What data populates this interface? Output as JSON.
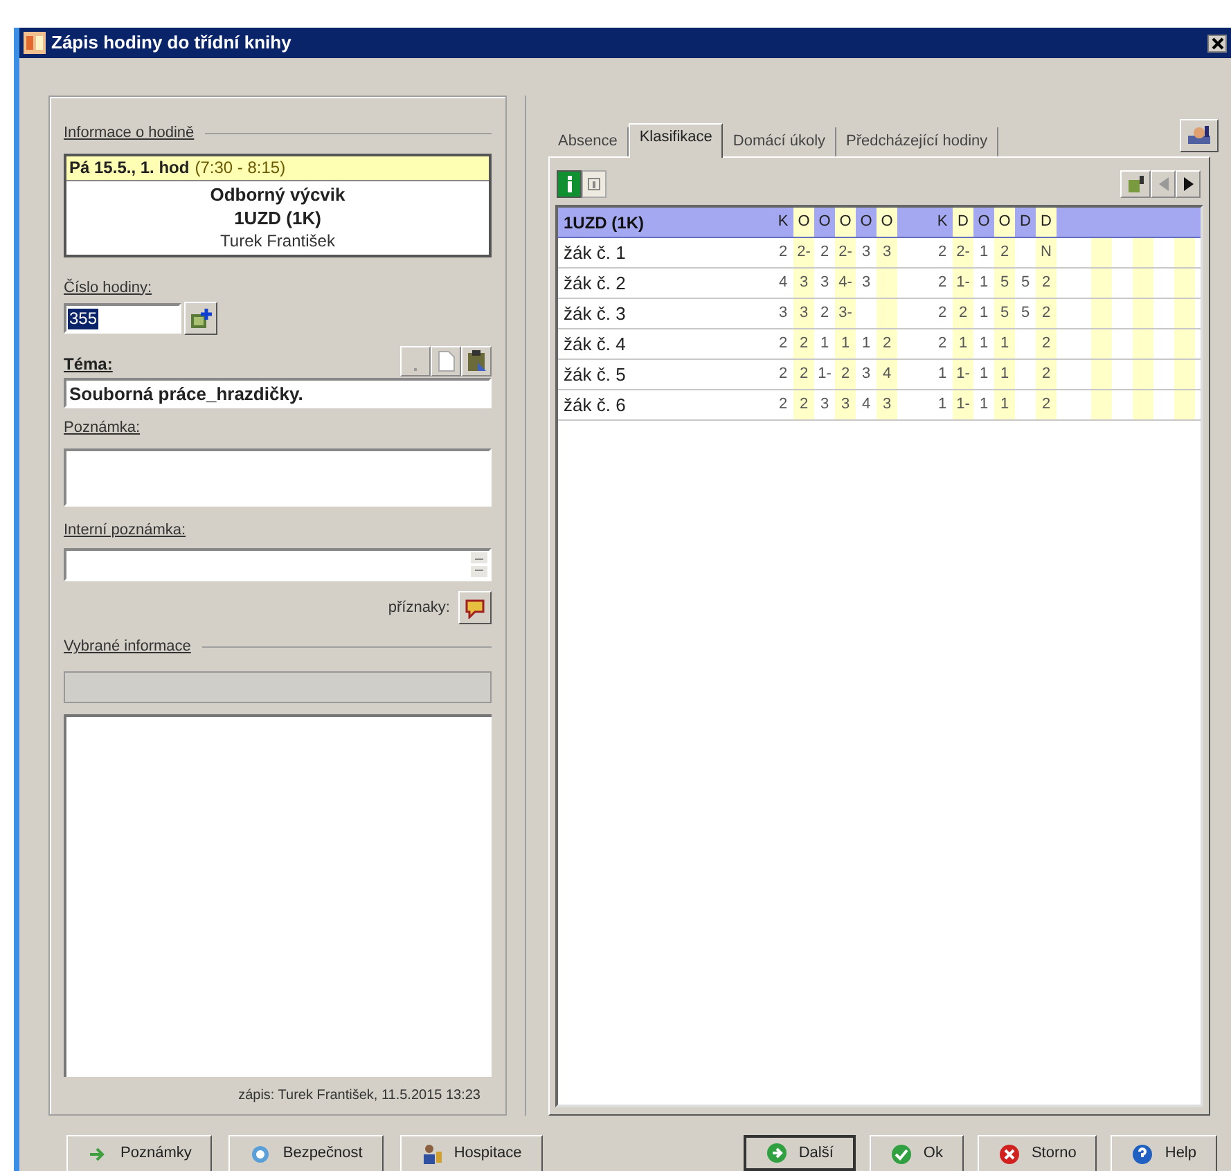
{
  "window": {
    "title": "Zápis hodiny do třídní knihy"
  },
  "lesson_info": {
    "heading": "Informace o hodině",
    "date": "Pá 15.5., 1. hod",
    "time": "(7:30 - 8:15)",
    "subject": "Odborný výcvik",
    "class": "1UZD (1K)",
    "teacher": "Turek František"
  },
  "lesson_number": {
    "label": "Číslo hodiny:",
    "value": "355"
  },
  "topic": {
    "label": "Téma:",
    "value": "Souborná práce_hrazdičky."
  },
  "note": {
    "label": "Poznámka:"
  },
  "internal_note": {
    "label": "Interní poznámka:"
  },
  "flags": {
    "label": "příznaky:"
  },
  "selected_info": {
    "heading": "Vybrané informace"
  },
  "entry_footer": "zápis: Turek František, 11.5.2015 13:23",
  "tabs": [
    {
      "label": "Absence",
      "selected": false
    },
    {
      "label": "Klasifikace",
      "selected": true
    },
    {
      "label": "Domácí úkoly",
      "selected": false
    },
    {
      "label": "Předcházející hodiny",
      "selected": false
    }
  ],
  "grades": {
    "class": "1UZD (1K)",
    "columns_a": [
      "K",
      "O",
      "O",
      "O",
      "O",
      "O"
    ],
    "columns_b": [
      "K",
      "D",
      "O",
      "O",
      "D",
      "D"
    ],
    "rows": [
      {
        "name": "žák č. 1",
        "a": [
          {
            "value": "2"
          },
          {
            "value": "2-"
          },
          {
            "value": "2"
          },
          {
            "value": "2-"
          },
          {
            "value": "3"
          },
          {
            "value": "3"
          }
        ],
        "b": [
          {
            "value": "2"
          },
          {
            "value": "2-"
          },
          {
            "value": "1"
          },
          {
            "value": "2"
          },
          {
            "blank": true
          },
          {
            "value": "N"
          }
        ]
      },
      {
        "name": "žák č. 2",
        "a": [
          {
            "value": "4"
          },
          {
            "value": "3"
          },
          {
            "value": "3"
          },
          {
            "value": "4-"
          },
          {
            "value": "3"
          },
          {
            "blank": true
          }
        ],
        "b": [
          {
            "value": "2"
          },
          {
            "value": "1-"
          },
          {
            "value": "1"
          },
          {
            "value": "5"
          },
          {
            "value": "5"
          },
          {
            "value": "2"
          }
        ]
      },
      {
        "name": "žák č. 3",
        "a": [
          {
            "value": "3"
          },
          {
            "value": "3"
          },
          {
            "value": "2"
          },
          {
            "value": "3-"
          },
          {
            "blank": true
          },
          {
            "blank": true
          }
        ],
        "b": [
          {
            "value": "2"
          },
          {
            "value": "2"
          },
          {
            "value": "1"
          },
          {
            "value": "5"
          },
          {
            "value": "5"
          },
          {
            "value": "2"
          }
        ]
      },
      {
        "name": "žák č. 4",
        "a": [
          {
            "value": "2"
          },
          {
            "value": "2"
          },
          {
            "value": "1"
          },
          {
            "value": "1"
          },
          {
            "value": "1"
          },
          {
            "value": "2"
          }
        ],
        "b": [
          {
            "value": "2"
          },
          {
            "value": "1"
          },
          {
            "value": "1"
          },
          {
            "value": "1"
          },
          {
            "blank": true
          },
          {
            "value": "2"
          }
        ]
      },
      {
        "name": "žák č. 5",
        "a": [
          {
            "value": "2"
          },
          {
            "value": "2"
          },
          {
            "value": "1-"
          },
          {
            "value": "2"
          },
          {
            "value": "3"
          },
          {
            "value": "4"
          }
        ],
        "b": [
          {
            "value": "1"
          },
          {
            "value": "1-"
          },
          {
            "value": "1"
          },
          {
            "value": "1"
          },
          {
            "blank": true
          },
          {
            "value": "2"
          }
        ]
      },
      {
        "name": "žák č. 6",
        "a": [
          {
            "value": "2"
          },
          {
            "value": "2"
          },
          {
            "value": "3"
          },
          {
            "value": "3"
          },
          {
            "value": "4"
          },
          {
            "value": "3"
          }
        ],
        "b": [
          {
            "value": "1"
          },
          {
            "value": "1-"
          },
          {
            "value": "1"
          },
          {
            "value": "1"
          },
          {
            "blank": true
          },
          {
            "value": "2"
          }
        ]
      }
    ]
  },
  "buttons_left": [
    {
      "label": "Poznámky",
      "kind": "notes"
    },
    {
      "label": "Bezpečnost",
      "kind": "safety"
    },
    {
      "label": "Hospitace",
      "kind": "inspection"
    }
  ],
  "buttons_right": [
    {
      "label": "Další",
      "kind": "next",
      "default": true
    },
    {
      "label": "Ok",
      "kind": "ok",
      "default": false
    },
    {
      "label": "Storno",
      "kind": "cancel",
      "default": false
    },
    {
      "label": "Help",
      "kind": "help",
      "default": false
    }
  ]
}
